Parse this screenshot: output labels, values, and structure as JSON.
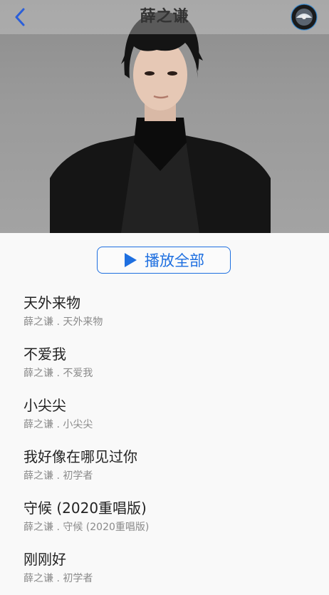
{
  "header": {
    "title": "薛之谦",
    "back_icon": "chevron-left-icon",
    "disc_icon": "vinyl-disc-icon"
  },
  "accent_color": "#1e6fe0",
  "play_all": {
    "label": "播放全部",
    "icon": "play-icon"
  },
  "songs": [
    {
      "title": "天外来物",
      "artist": "薛之谦",
      "sep": ".",
      "album": "天外来物"
    },
    {
      "title": "不爱我",
      "artist": "薛之谦",
      "sep": ".",
      "album": "不爱我"
    },
    {
      "title": "小尖尖",
      "artist": "薛之谦",
      "sep": ".",
      "album": "小尖尖"
    },
    {
      "title": "我好像在哪见过你",
      "artist": "薛之谦",
      "sep": ".",
      "album": "初学者"
    },
    {
      "title": "守候 (2020重唱版)",
      "artist": "薛之谦",
      "sep": ".",
      "album": "守候 (2020重唱版)"
    },
    {
      "title": "刚刚好",
      "artist": "薛之谦",
      "sep": ".",
      "album": "初学者"
    }
  ]
}
